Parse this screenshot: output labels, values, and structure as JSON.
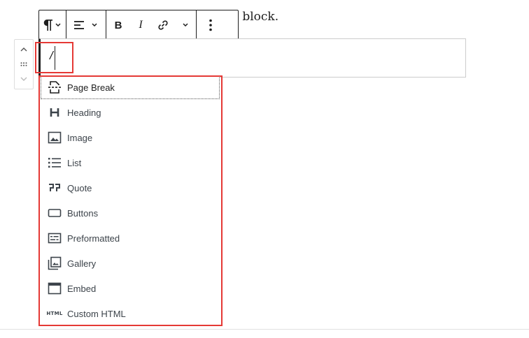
{
  "paragraph": {
    "text_fragment": "h block."
  },
  "block": {
    "input_value": "/"
  },
  "toolbar": {
    "paragraph_tooltip": "Paragraph",
    "align_tooltip": "Align",
    "bold_tooltip": "Bold",
    "italic_tooltip": "Italic",
    "link_tooltip": "Link",
    "more_tooltip": "More options"
  },
  "inserter": {
    "items": [
      {
        "label": "Page Break",
        "icon": "page-break-icon"
      },
      {
        "label": "Heading",
        "icon": "heading-icon"
      },
      {
        "label": "Image",
        "icon": "image-icon"
      },
      {
        "label": "List",
        "icon": "list-icon"
      },
      {
        "label": "Quote",
        "icon": "quote-icon"
      },
      {
        "label": "Buttons",
        "icon": "buttons-icon"
      },
      {
        "label": "Preformatted",
        "icon": "preformatted-icon"
      },
      {
        "label": "Gallery",
        "icon": "gallery-icon"
      },
      {
        "label": "Embed",
        "icon": "embed-icon"
      },
      {
        "label": "Custom HTML",
        "icon": "html-icon",
        "icon_text": "HTML"
      }
    ]
  },
  "colors": {
    "highlight": "#e53935",
    "icon": "#1e1e1e",
    "text": "#3c434a"
  }
}
